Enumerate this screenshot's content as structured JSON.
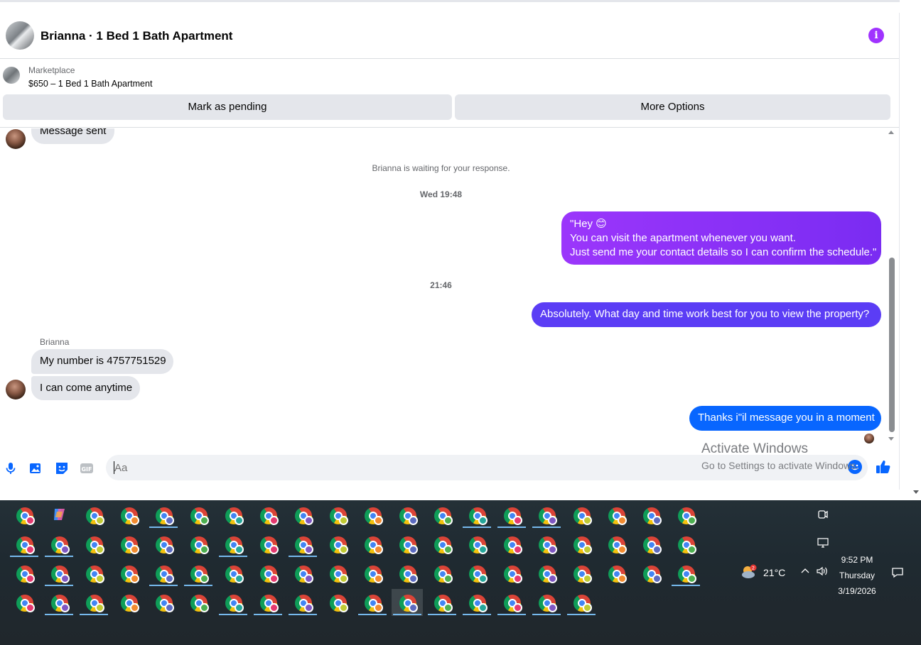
{
  "header": {
    "title": "Brianna · 1 Bed 1 Bath Apartment",
    "info_icon": "info-icon"
  },
  "listing": {
    "source": "Marketplace",
    "price_title": "$650 – 1 Bed 1 Bath Apartment",
    "mark_pending_label": "Mark as pending",
    "more_options_label": "More Options"
  },
  "messages": {
    "message_sent": "Message sent",
    "waiting_notice": "Brianna is waiting for your response.",
    "stamp1": "Wed 19:48",
    "out1_line1": "\"Hey 😊",
    "out1_line2": "You can visit the apartment whenever you want.",
    "out1_line3": "Just send me your contact details so I can confirm the schedule.\"",
    "stamp2": "21:46",
    "out2": "Absolutely. What day and time work best for you to view the property?",
    "sender_name": "Brianna",
    "in1": "My number is 4757751529",
    "in2": "I can come anytime",
    "out3": "Thanks i\"il message you in a moment"
  },
  "composer": {
    "placeholder": "Aa",
    "icons": [
      "microphone-icon",
      "photo-icon",
      "sticker-icon",
      "gif-icon",
      "emoji-icon",
      "like-icon"
    ]
  },
  "watermark": {
    "title": "Activate Windows",
    "subtitle": "Go to Settings to activate Windows."
  },
  "tray": {
    "temperature": "21°C",
    "time": "9:52 PM",
    "day": "Thursday",
    "date": "3/19/2026"
  },
  "colors": {
    "gradient_top": "#a033ff",
    "gradient_mid": "#5b3df5",
    "bubble_blue": "#0866ff",
    "incoming_bubble": "#e4e6eb"
  }
}
